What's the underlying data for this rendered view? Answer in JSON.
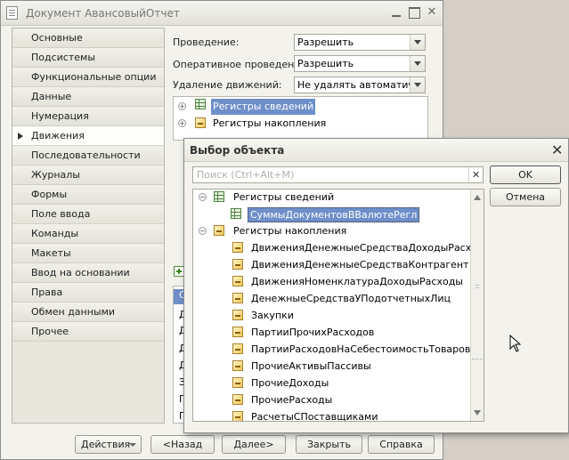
{
  "main_window": {
    "title": "Документ АвансовыйОтчет",
    "nav_items": [
      {
        "label": "Основные",
        "active": false
      },
      {
        "label": "Подсистемы",
        "active": false
      },
      {
        "label": "Функциональные опции",
        "active": false
      },
      {
        "label": "Данные",
        "active": false
      },
      {
        "label": "Нумерация",
        "active": false
      },
      {
        "label": "Движения",
        "active": true
      },
      {
        "label": "Последовательности",
        "active": false
      },
      {
        "label": "Журналы",
        "active": false
      },
      {
        "label": "Формы",
        "active": false
      },
      {
        "label": "Поле ввода",
        "active": false
      },
      {
        "label": "Команды",
        "active": false
      },
      {
        "label": "Макеты",
        "active": false
      },
      {
        "label": "Ввод на основании",
        "active": false
      },
      {
        "label": "Права",
        "active": false
      },
      {
        "label": "Обмен данными",
        "active": false
      },
      {
        "label": "Прочее",
        "active": false
      }
    ],
    "fields": {
      "posting_label": "Проведение:",
      "posting_value": "Разрешить",
      "realtime_posting_label": "Оперативное проведение:",
      "realtime_posting_value": "Разрешить",
      "delete_movements_label": "Удаление движений:",
      "delete_movements_value": "Не удалять автоматически"
    },
    "register_tree": [
      {
        "label": "Регистры сведений",
        "icon": "table-icon",
        "selected": true
      },
      {
        "label": "Регистры накопления",
        "icon": "accumulation-icon",
        "selected": false
      }
    ],
    "lower_list_cells": [
      "С",
      "Д",
      "Д",
      "Д",
      "Д",
      "З",
      "П",
      "П"
    ],
    "buttons": {
      "actions": "Действия",
      "back": "<Назад",
      "next": "Далее>",
      "close": "Закрыть",
      "help": "Справка"
    }
  },
  "dialog": {
    "title": "Выбор объекта",
    "search_placeholder": "Поиск (Ctrl+Alt+M)",
    "ok_label": "OK",
    "cancel_label": "Отмена",
    "tree": {
      "info_registers_label": "Регистры сведений",
      "info_register_children": [
        "СуммыДокументовВВалютеРегл"
      ],
      "accumulation_registers_label": "Регистры накопления",
      "accumulation_register_children": [
        "ДвиженияДенежныеСредстваДоходыРасходы",
        "ДвиженияДенежныеСредстваКонтрагент",
        "ДвиженияНоменклатураДоходыРасходы",
        "ДенежныеСредстваУПодотчетныхЛиц",
        "Закупки",
        "ПартииПрочихРасходов",
        "ПартииРасходовНаСебестоимостьТоваров",
        "ПрочиеАктивыПассивы",
        "ПрочиеДоходы",
        "ПрочиеРасходы",
        "РасчетыСПоставщиками"
      ]
    }
  },
  "colors": {
    "selection": "#6e8fc9",
    "window_bg": "#f3f2ec",
    "desktop_bg": "#d4d0c8"
  }
}
